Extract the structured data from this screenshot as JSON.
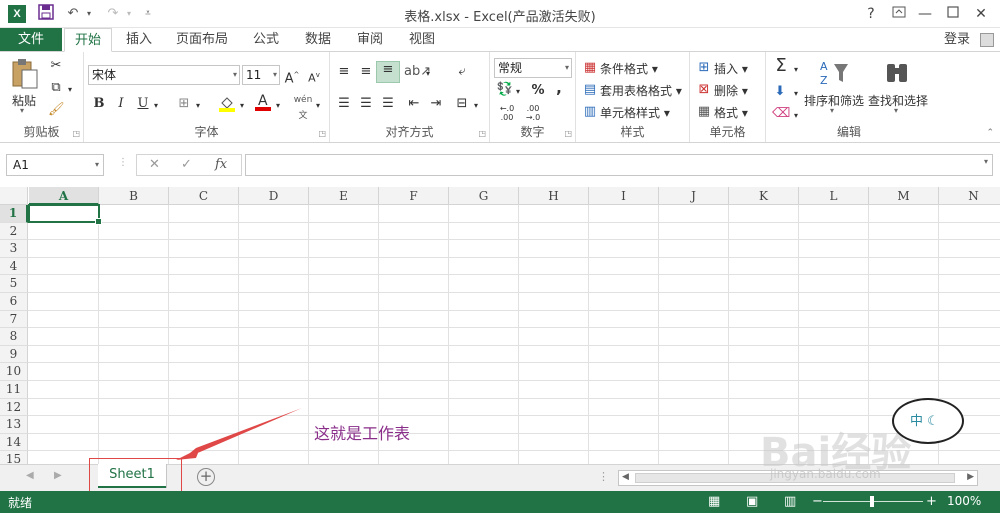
{
  "window": {
    "title": "表格.xlsx - Excel(产品激活失败)",
    "logo_text": "X"
  },
  "qat": {
    "save_icon": "save-icon",
    "undo_icon": "undo-icon",
    "redo_icon": "redo-icon"
  },
  "window_buttons": {
    "help": "?",
    "ribbon_opts": "ribbon-display-icon"
  },
  "tabs": [
    {
      "label": "文件"
    },
    {
      "label": "开始"
    },
    {
      "label": "插入"
    },
    {
      "label": "页面布局"
    },
    {
      "label": "公式"
    },
    {
      "label": "数据"
    },
    {
      "label": "审阅"
    },
    {
      "label": "视图"
    }
  ],
  "login_label": "登录",
  "ribbon": {
    "clipboard": {
      "label": "剪贴板",
      "paste": "粘贴"
    },
    "font": {
      "label": "字体",
      "font_name": "宋体",
      "font_size": "11",
      "bold": "B",
      "italic": "I",
      "underline": "U",
      "phonetic": "wén"
    },
    "alignment": {
      "label": "对齐方式"
    },
    "number": {
      "label": "数字",
      "format": "常规",
      "percent": "%",
      "comma": ","
    },
    "styles": {
      "label": "样式",
      "conditional": "条件格式",
      "table": "套用表格格式",
      "cell": "单元格样式"
    },
    "cells": {
      "label": "单元格",
      "insert": "插入",
      "delete": "删除",
      "format": "格式"
    },
    "editing": {
      "label": "编辑",
      "sort": "排序和筛选",
      "find": "查找和选择"
    }
  },
  "formula_bar": {
    "name_box": "A1",
    "fx": "fx",
    "cancel": "✕",
    "enter": "✓"
  },
  "columns": [
    "A",
    "B",
    "C",
    "D",
    "E",
    "F",
    "G",
    "H",
    "I",
    "J",
    "K",
    "L",
    "M",
    "N"
  ],
  "rows": [
    "1",
    "2",
    "3",
    "4",
    "5",
    "6",
    "7",
    "8",
    "9",
    "10",
    "11",
    "12",
    "13",
    "14",
    "15"
  ],
  "selected_cell": "A1",
  "sheets": [
    {
      "name": "Sheet1",
      "active": true
    }
  ],
  "status": {
    "text": "就绪",
    "zoom": "100%"
  },
  "annotation": {
    "text": "这就是工作表",
    "color": "#8a2e8a"
  },
  "watermark": {
    "text": "Bai经验",
    "sub": "jingyan.baidu.com"
  },
  "colors": {
    "accent": "#217346",
    "annotation_box": "#e04848"
  }
}
